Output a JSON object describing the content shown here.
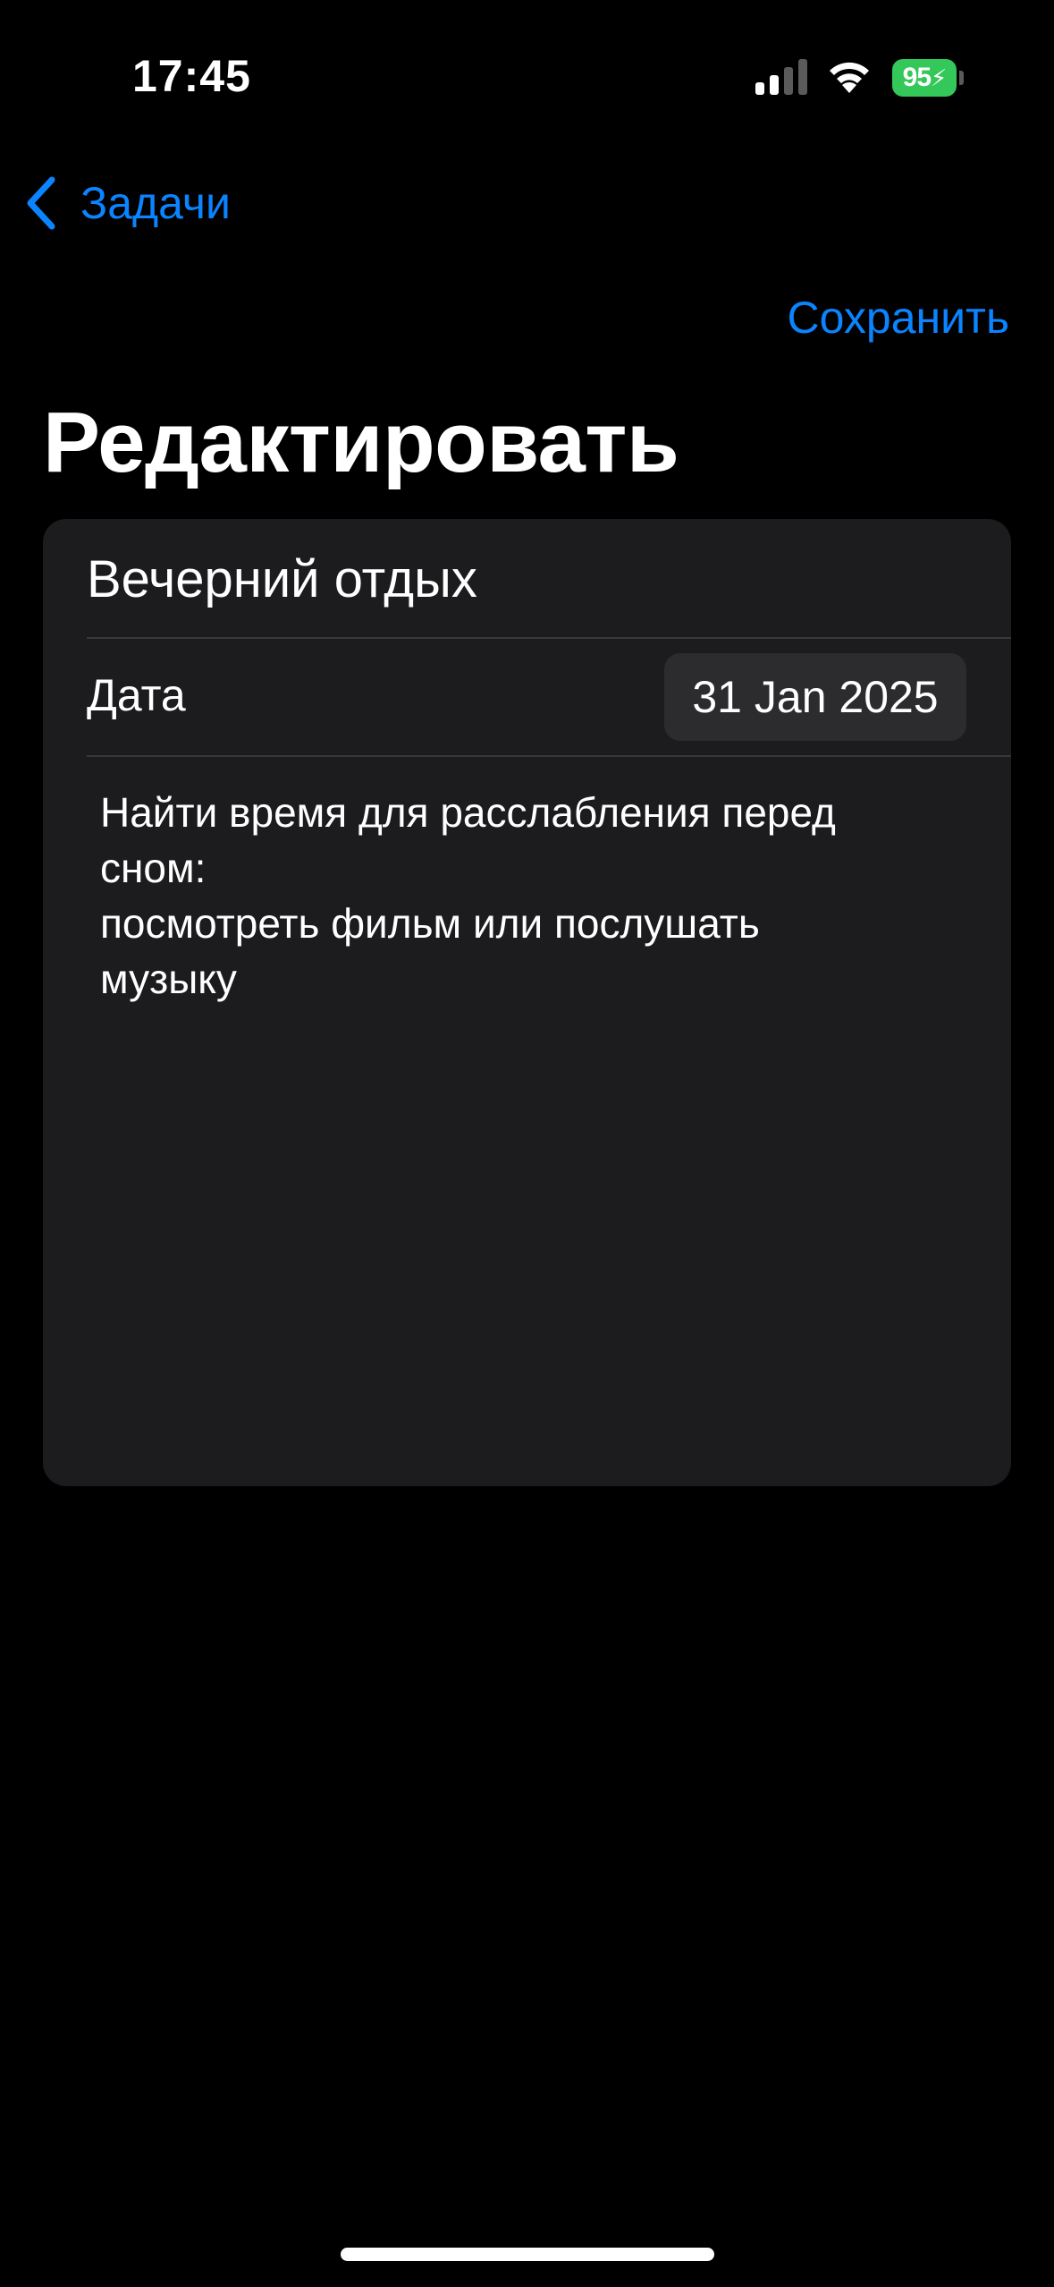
{
  "status_bar": {
    "time": "17:45",
    "battery_level": "95"
  },
  "nav": {
    "back_label": "Задачи",
    "save_label": "Сохранить"
  },
  "page": {
    "title": "Редактировать"
  },
  "form": {
    "task_title": "Вечерний отдых",
    "date_label": "Дата",
    "date_value": "31 Jan 2025",
    "notes_lines": [
      "Найти время для расслабления перед",
      "сном:",
      "посмотреть фильм или послушать",
      "музыку"
    ]
  },
  "colors": {
    "accent": "#0a84ff",
    "background": "#000000",
    "card": "#1c1c1e",
    "battery": "#34c759"
  },
  "icons": {
    "signal": "cellular-signal-icon",
    "wifi": "wifi-icon",
    "battery": "battery-charging-icon",
    "back": "chevron-left-icon"
  }
}
